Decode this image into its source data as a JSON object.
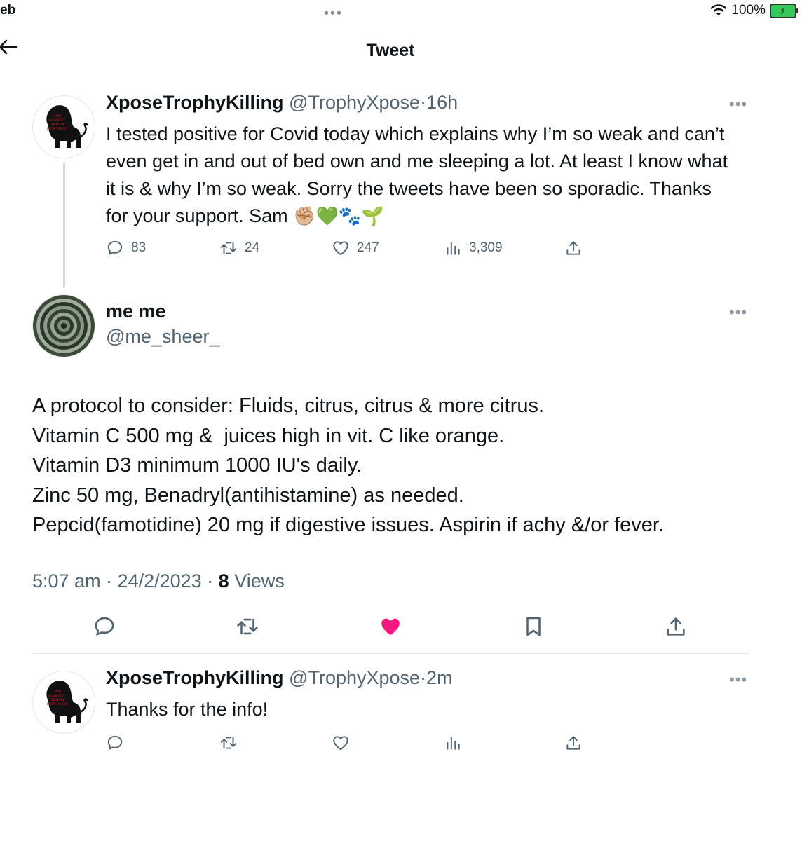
{
  "status_bar": {
    "left_text": "eb",
    "battery_percent": "100%"
  },
  "header": {
    "title": "Tweet"
  },
  "parent_tweet": {
    "author_name": "XposeTrophyKilling",
    "handle": "@TrophyXpose",
    "time": "16h",
    "text": "I tested positive for Covid today which explains why I’m so weak and can’t even get in and out of bed own and me sleeping a lot. At least I know what it is & why I’m so weak. Sorry the tweets have been so sporadic. Thanks for your support. Sam",
    "emojis": "✊🏼💚🐾🌱",
    "replies": "83",
    "retweets": "24",
    "likes": "247",
    "views": "3,309"
  },
  "main_tweet": {
    "author_name": "me me",
    "handle": "@me_sheer_",
    "text": "A protocol to consider: Fluids, citrus, citrus & more citrus.\nVitamin C 500 mg &  juices high in vit. C like orange.\nVitamin D3 minimum 1000 IU's daily.\nZinc 50 mg, Benadryl(antihistamine) as needed.\nPepcid(famotidine) 20 mg if digestive issues. Aspirin if achy &/or fever.",
    "timestamp": "5:07 am · 24/2/2023 · ",
    "views_count": "8",
    "views_label": " Views",
    "liked": true,
    "like_color": "#f91880"
  },
  "reply_tweet": {
    "author_name": "XposeTrophyKilling",
    "handle": "@TrophyXpose",
    "time": "2m",
    "text": "Thanks for the info!"
  },
  "avatar_logo_text": [
    "I AM",
    "AGAINST",
    "TROPHY",
    "HUNTING!"
  ]
}
